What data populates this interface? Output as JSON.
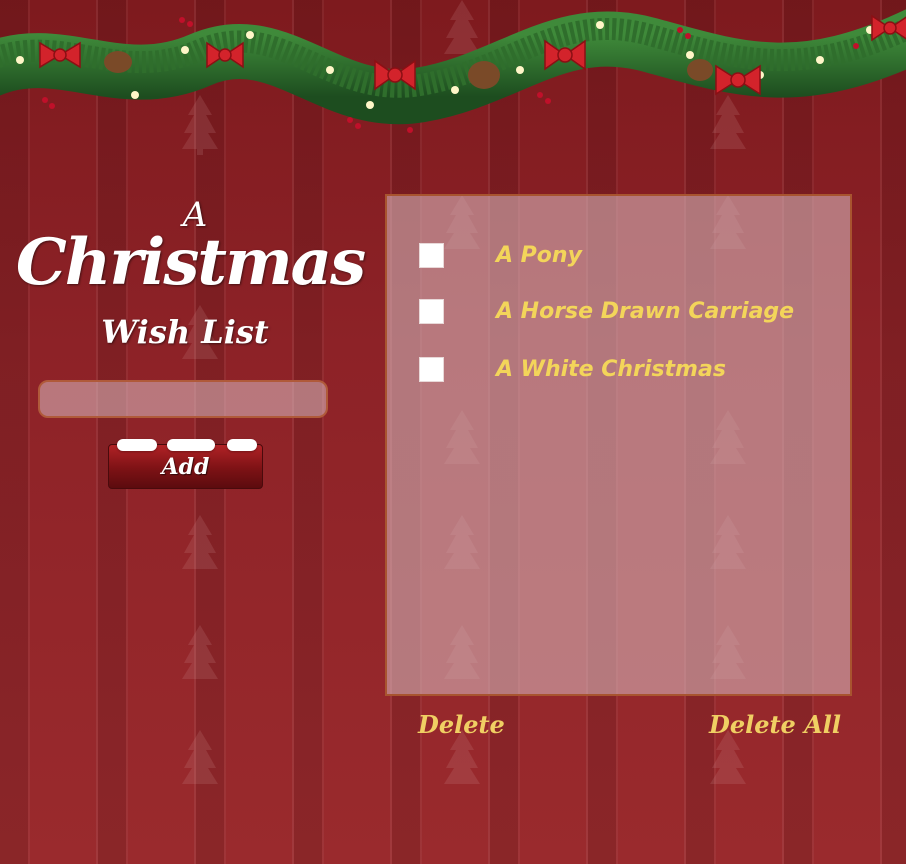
{
  "title": {
    "line1": "A",
    "line2": "Christmas",
    "line3": "Wish List"
  },
  "input": {
    "value": "",
    "placeholder": ""
  },
  "buttons": {
    "add_label": "Add",
    "delete_label": "Delete",
    "delete_all_label": "Delete All"
  },
  "wishes": [
    {
      "text": "A Pony",
      "checked": false
    },
    {
      "text": "A Horse Drawn Carriage",
      "checked": false
    },
    {
      "text": "A White Christmas",
      "checked": false
    }
  ],
  "colors": {
    "background": "#8d2227",
    "wish_text": "#f3d55a",
    "link_text": "#f0cf63",
    "panel_border": "#a8542f"
  },
  "icons": [
    "garland-decoration",
    "christmas-tree-pattern"
  ]
}
